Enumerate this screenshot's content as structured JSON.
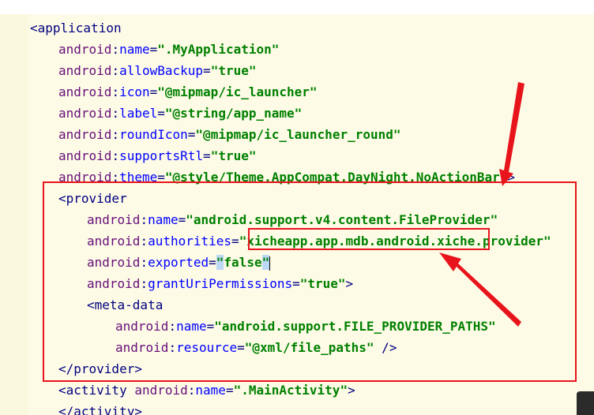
{
  "lines": [
    {
      "indent": 0,
      "parts": [
        [
          "tag",
          "<application"
        ]
      ]
    },
    {
      "indent": 1,
      "parts": [
        [
          "ns",
          "android"
        ],
        [
          "punc",
          ":"
        ],
        [
          "attr",
          "name"
        ],
        [
          "punc",
          "="
        ],
        [
          "val",
          "\".MyApplication\""
        ]
      ]
    },
    {
      "indent": 1,
      "parts": [
        [
          "ns",
          "android"
        ],
        [
          "punc",
          ":"
        ],
        [
          "attr",
          "allowBackup"
        ],
        [
          "punc",
          "="
        ],
        [
          "val",
          "\"true\""
        ]
      ]
    },
    {
      "indent": 1,
      "parts": [
        [
          "ns",
          "android"
        ],
        [
          "punc",
          ":"
        ],
        [
          "attr",
          "icon"
        ],
        [
          "punc",
          "="
        ],
        [
          "val",
          "\"@mipmap/ic_launcher\""
        ]
      ]
    },
    {
      "indent": 1,
      "parts": [
        [
          "ns",
          "android"
        ],
        [
          "punc",
          ":"
        ],
        [
          "attr",
          "label"
        ],
        [
          "punc",
          "="
        ],
        [
          "val",
          "\"@string/app_name\""
        ]
      ]
    },
    {
      "indent": 1,
      "parts": [
        [
          "ns",
          "android"
        ],
        [
          "punc",
          ":"
        ],
        [
          "attr",
          "roundIcon"
        ],
        [
          "punc",
          "="
        ],
        [
          "val",
          "\"@mipmap/ic_launcher_round\""
        ]
      ]
    },
    {
      "indent": 1,
      "parts": [
        [
          "ns",
          "android"
        ],
        [
          "punc",
          ":"
        ],
        [
          "attr",
          "supportsRtl"
        ],
        [
          "punc",
          "="
        ],
        [
          "val",
          "\"true\""
        ]
      ]
    },
    {
      "indent": 1,
      "parts": [
        [
          "ns",
          "android"
        ],
        [
          "punc",
          ":"
        ],
        [
          "attr",
          "theme"
        ],
        [
          "punc",
          "="
        ],
        [
          "val",
          "\"@style/Theme.AppCompat.DayNight.NoActionBar\""
        ],
        [
          "tag",
          ">"
        ]
      ]
    },
    {
      "indent": 1,
      "parts": [
        [
          "tag",
          "<provider"
        ]
      ]
    },
    {
      "indent": 2,
      "parts": [
        [
          "ns",
          "android"
        ],
        [
          "punc",
          ":"
        ],
        [
          "attr",
          "name"
        ],
        [
          "punc",
          "="
        ],
        [
          "val",
          "\"android.support.v4.content.FileProvider\""
        ]
      ]
    },
    {
      "indent": 2,
      "parts": [
        [
          "ns",
          "android"
        ],
        [
          "punc",
          ":"
        ],
        [
          "attr",
          "authorities"
        ],
        [
          "punc",
          "="
        ],
        [
          "val",
          "\"xicheapp.app.mdb.android.xiche.provider\""
        ]
      ]
    },
    {
      "indent": 2,
      "parts": [
        [
          "ns",
          "android"
        ],
        [
          "punc",
          ":"
        ],
        [
          "attr",
          "exported"
        ],
        [
          "punc",
          "="
        ],
        [
          "caret",
          "\""
        ],
        [
          "val",
          "false"
        ],
        [
          "caret",
          "\""
        ],
        [
          "cursor",
          ""
        ]
      ]
    },
    {
      "indent": 2,
      "parts": [
        [
          "ns",
          "android"
        ],
        [
          "punc",
          ":"
        ],
        [
          "attr",
          "grantUriPermissions"
        ],
        [
          "punc",
          "="
        ],
        [
          "val",
          "\"true\""
        ],
        [
          "tag",
          ">"
        ]
      ]
    },
    {
      "indent": 2,
      "parts": [
        [
          "tag",
          "<meta-data"
        ]
      ]
    },
    {
      "indent": 3,
      "parts": [
        [
          "ns",
          "android"
        ],
        [
          "punc",
          ":"
        ],
        [
          "attr",
          "name"
        ],
        [
          "punc",
          "="
        ],
        [
          "val",
          "\"android.support.FILE_PROVIDER_PATHS\""
        ]
      ]
    },
    {
      "indent": 3,
      "parts": [
        [
          "ns",
          "android"
        ],
        [
          "punc",
          ":"
        ],
        [
          "attr",
          "resource"
        ],
        [
          "punc",
          "="
        ],
        [
          "val",
          "\"@xml/file_paths\""
        ],
        [
          "tag",
          " />"
        ]
      ]
    },
    {
      "indent": 1,
      "parts": [
        [
          "tag",
          "</provider>"
        ]
      ]
    },
    {
      "indent": 1,
      "parts": [
        [
          "tag",
          "<activity "
        ],
        [
          "ns",
          "android"
        ],
        [
          "punc",
          ":"
        ],
        [
          "attr",
          "name"
        ],
        [
          "punc",
          "="
        ],
        [
          "val",
          "\".MainActivity\""
        ],
        [
          "tag",
          ">"
        ]
      ]
    },
    {
      "indent": 1,
      "parts": [
        [
          "tag",
          "</activity>"
        ]
      ]
    }
  ],
  "colors": {
    "annotation": "#e8141c",
    "editor_bg": "#fdfbe6"
  }
}
